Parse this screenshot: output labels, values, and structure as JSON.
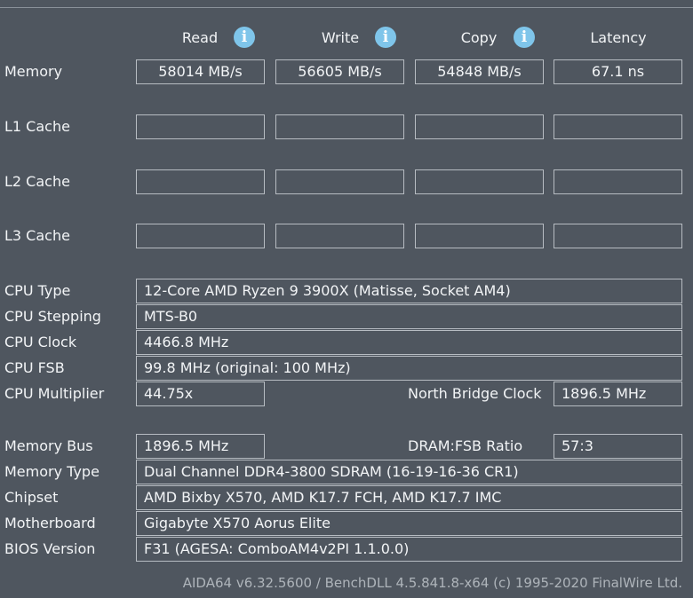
{
  "headers": {
    "read": "Read",
    "write": "Write",
    "copy": "Copy",
    "latency": "Latency"
  },
  "info_icon_glyph": "i",
  "bench_rows": [
    {
      "label": "Memory",
      "read": "58014 MB/s",
      "write": "56605 MB/s",
      "copy": "54848 MB/s",
      "latency": "67.1 ns"
    },
    {
      "label": "L1 Cache",
      "read": "",
      "write": "",
      "copy": "",
      "latency": ""
    },
    {
      "label": "L2 Cache",
      "read": "",
      "write": "",
      "copy": "",
      "latency": ""
    },
    {
      "label": "L3 Cache",
      "read": "",
      "write": "",
      "copy": "",
      "latency": ""
    }
  ],
  "cpu": {
    "type_label": "CPU Type",
    "type_value": "12-Core AMD Ryzen 9 3900X  (Matisse, Socket AM4)",
    "stepping_label": "CPU Stepping",
    "stepping_value": "MTS-B0",
    "clock_label": "CPU Clock",
    "clock_value": "4466.8 MHz",
    "fsb_label": "CPU FSB",
    "fsb_value": "99.8 MHz  (original: 100 MHz)",
    "multiplier_label": "CPU Multiplier",
    "multiplier_value": "44.75x",
    "nb_clock_label": "North Bridge Clock",
    "nb_clock_value": "1896.5 MHz"
  },
  "memory": {
    "bus_label": "Memory Bus",
    "bus_value": "1896.5 MHz",
    "ratio_label": "DRAM:FSB Ratio",
    "ratio_value": "57:3",
    "type_label": "Memory Type",
    "type_value": "Dual Channel DDR4-3800 SDRAM  (16-19-16-36 CR1)",
    "chipset_label": "Chipset",
    "chipset_value": "AMD Bixby X570, AMD K17.7 FCH, AMD K17.7 IMC",
    "motherboard_label": "Motherboard",
    "motherboard_value": "Gigabyte X570 Aorus Elite",
    "bios_label": "BIOS Version",
    "bios_value": "F31  (AGESA: ComboAM4v2PI 1.1.0.0)"
  },
  "footer": "AIDA64 v6.32.5600 / BenchDLL 4.5.841.8-x64  (c) 1995-2020 FinalWire Ltd."
}
